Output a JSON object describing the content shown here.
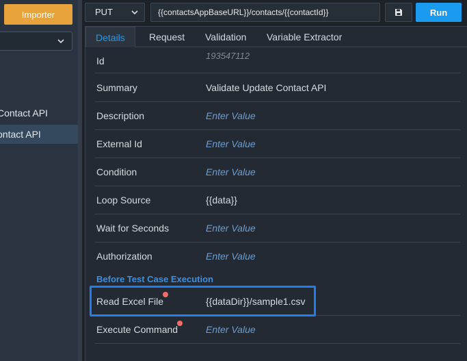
{
  "sidebar": {
    "importer_label": "Importer",
    "items": [
      {
        "label": "Contact API",
        "active": false
      },
      {
        "label": "ontact API",
        "active": true
      }
    ]
  },
  "request": {
    "method": "PUT",
    "url": "{{contactsAppBaseURL}}/contacts/{{contactId}}",
    "run_label": "Run"
  },
  "tabs": [
    {
      "label": "Details",
      "active": true
    },
    {
      "label": "Request",
      "active": false
    },
    {
      "label": "Validation",
      "active": false
    },
    {
      "label": "Variable Extractor",
      "active": false
    }
  ],
  "details": {
    "id": {
      "label": "Id",
      "value": "193547112"
    },
    "summary": {
      "label": "Summary",
      "value": "Validate Update Contact API"
    },
    "description": {
      "label": "Description",
      "placeholder": "Enter Value"
    },
    "external_id": {
      "label": "External Id",
      "placeholder": "Enter Value"
    },
    "condition": {
      "label": "Condition",
      "placeholder": "Enter Value"
    },
    "loop_source": {
      "label": "Loop Source",
      "value": "{{data}}"
    },
    "wait_for_seconds": {
      "label": "Wait for Seconds",
      "placeholder": "Enter Value"
    },
    "authorization": {
      "label": "Authorization",
      "placeholder": "Enter Value"
    }
  },
  "before_test_case": {
    "heading": "Before Test Case Execution",
    "read_excel_file": {
      "label": "Read Excel File",
      "value": "{{dataDir}}/sample1.csv"
    },
    "execute_command": {
      "label": "Execute Command",
      "placeholder": "Enter Value"
    }
  },
  "colors": {
    "accent": "#1a9bf0",
    "importer": "#e8a33c",
    "required_dot": "#f36b6b",
    "highlight": "#1f7ff0"
  },
  "icons": [
    "chevron-down-icon",
    "save-icon"
  ]
}
